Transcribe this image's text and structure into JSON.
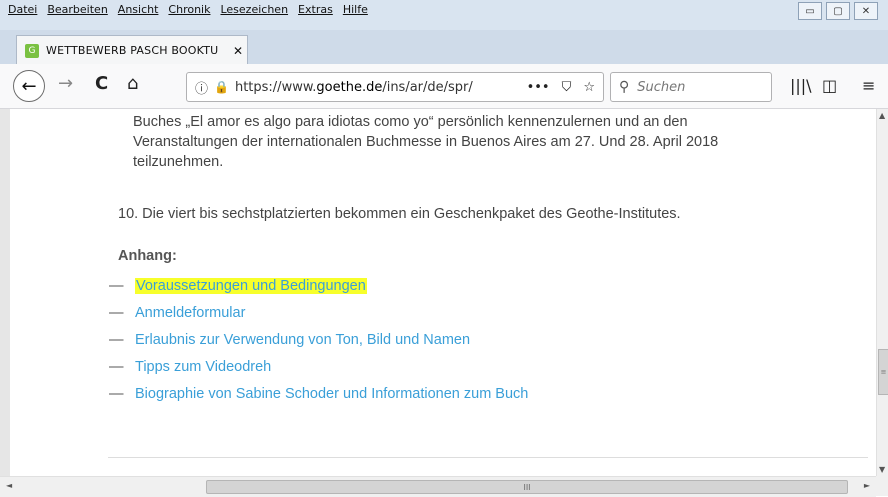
{
  "menu": [
    "Datei",
    "Bearbeiten",
    "Ansicht",
    "Chronik",
    "Lesezeichen",
    "Extras",
    "Hilfe"
  ],
  "window_controls": {
    "minimize": "▭",
    "maximize": "▢",
    "close": "✕"
  },
  "tab": {
    "title": "WETTBEWERB PASCH BOOKTU",
    "close": "✕"
  },
  "nav": {
    "back": "←",
    "forward": "→",
    "reload": "C",
    "home": "⌂",
    "info": "ⓘ",
    "lock": "🔒",
    "url_prefix": "https://www.",
    "url_domain": "goethe.de",
    "url_path": "/ins/ar/de/spr/",
    "more": "•••",
    "pocket": "⛉",
    "star": "☆",
    "search_placeholder": "Suchen",
    "library": "|||\\",
    "sidebar": "◫",
    "menu": "≡"
  },
  "content": {
    "para_lines": [
      "Buches „El amor es algo para idiotas como yo“ persönlich kennenzulernen und an den",
      "Veranstaltungen der internationalen Buchmesse in Buenos Aires am 27. Und 28. April 2018",
      "teilzunehmen."
    ],
    "item10": "10. Die viert bis sechstplatzierten bekommen ein Geschenkpaket des Geothe-Institutes.",
    "heading": "Anhang:",
    "dash": "—",
    "links": [
      "Voraussetzungen und Bedingungen",
      "Anmeldeformular",
      "Erlaubnis zur Verwendung von Ton, Bild und Namen",
      "Tipps zum Videodreh",
      "Biographie von Sabine Schoder und Informationen zum Buch"
    ]
  },
  "scroll": {
    "up": "▲",
    "down": "▼",
    "left": "◄",
    "right": "►",
    "grip": "≡",
    "hgrip": "III"
  }
}
